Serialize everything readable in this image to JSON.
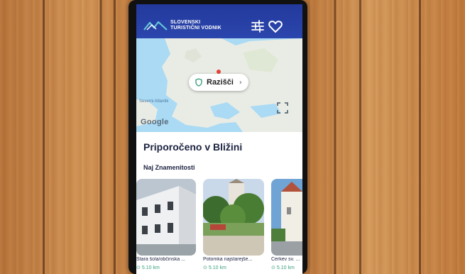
{
  "header": {
    "brand_line1": "SLOVENSKI",
    "brand_line2": "TURISTIČNI VODNIK",
    "filter_icon": "sliders-icon",
    "favorites_icon": "heart-icon",
    "colors": {
      "header_bg": "#2b46ad",
      "accent_green": "#3aa07a"
    }
  },
  "map": {
    "explore_label": "Razišči",
    "provider": "Google",
    "place_label": "Severni Atlantik",
    "fullscreen_icon": "fullscreen-icon"
  },
  "main": {
    "section_title": "Priporočeno v Bližini",
    "subsection_title": "Naj Znamenitosti",
    "cards": [
      {
        "title": "Stara šola/občinska ...",
        "distance": "5.10 km"
      },
      {
        "title": "Potomka najstarejše...",
        "distance": "5.10 km"
      },
      {
        "title": "Cerkev sv. ...",
        "distance": "5.10 km"
      }
    ]
  }
}
